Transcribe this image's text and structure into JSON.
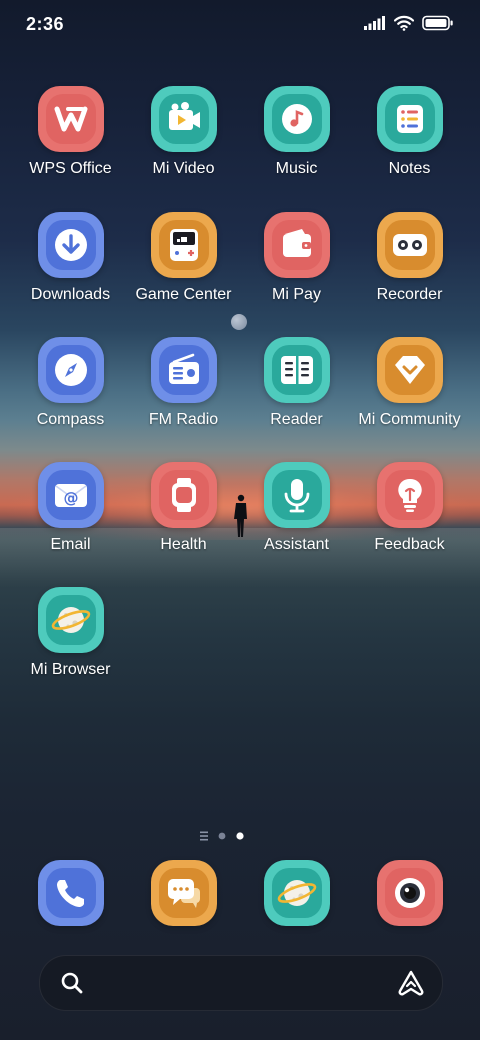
{
  "status_bar": {
    "time": "2:36",
    "icons": [
      "signal-icon",
      "wifi-icon",
      "battery-icon"
    ]
  },
  "apps": [
    {
      "label": "WPS Office",
      "icon": "wps-office-icon",
      "color": "#e7726f"
    },
    {
      "label": "Mi Video",
      "icon": "mi-video-icon",
      "color": "#4ecbbd"
    },
    {
      "label": "Music",
      "icon": "music-icon",
      "color": "#4ecbbd"
    },
    {
      "label": "Notes",
      "icon": "notes-icon",
      "color": "#4ecbbd"
    },
    {
      "label": "Downloads",
      "icon": "downloads-icon",
      "color": "#6f8fe8"
    },
    {
      "label": "Game Center",
      "icon": "game-center-icon",
      "color": "#eca84d"
    },
    {
      "label": "Mi Pay",
      "icon": "mi-pay-icon",
      "color": "#e7726f"
    },
    {
      "label": "Recorder",
      "icon": "recorder-icon",
      "color": "#eca84d"
    },
    {
      "label": "Compass",
      "icon": "compass-icon",
      "color": "#6f8fe8"
    },
    {
      "label": "FM Radio",
      "icon": "fm-radio-icon",
      "color": "#6f8fe8"
    },
    {
      "label": "Reader",
      "icon": "reader-icon",
      "color": "#4ecbbd"
    },
    {
      "label": "Mi Community",
      "icon": "mi-community-icon",
      "color": "#eca84d"
    },
    {
      "label": "Email",
      "icon": "email-icon",
      "color": "#6f8fe8"
    },
    {
      "label": "Health",
      "icon": "health-icon",
      "color": "#e7726f"
    },
    {
      "label": "Assistant",
      "icon": "assistant-mic-icon",
      "color": "#4ecbbd"
    },
    {
      "label": "Feedback",
      "icon": "feedback-icon",
      "color": "#e7726f"
    },
    {
      "label": "Mi Browser",
      "icon": "mi-browser-icon",
      "color": "#4ecbbd"
    }
  ],
  "page_indicator": {
    "pages": 2,
    "current": 2,
    "has_feed_page": true
  },
  "dock": [
    {
      "icon": "phone-icon",
      "color": "#6f8fe8"
    },
    {
      "icon": "messages-icon",
      "color": "#eca84d"
    },
    {
      "icon": "browser-icon",
      "color": "#4ecbbd"
    },
    {
      "icon": "camera-icon",
      "color": "#e7726f"
    }
  ],
  "search_bar": {
    "icons": [
      "search-icon",
      "assistant-icon"
    ]
  }
}
